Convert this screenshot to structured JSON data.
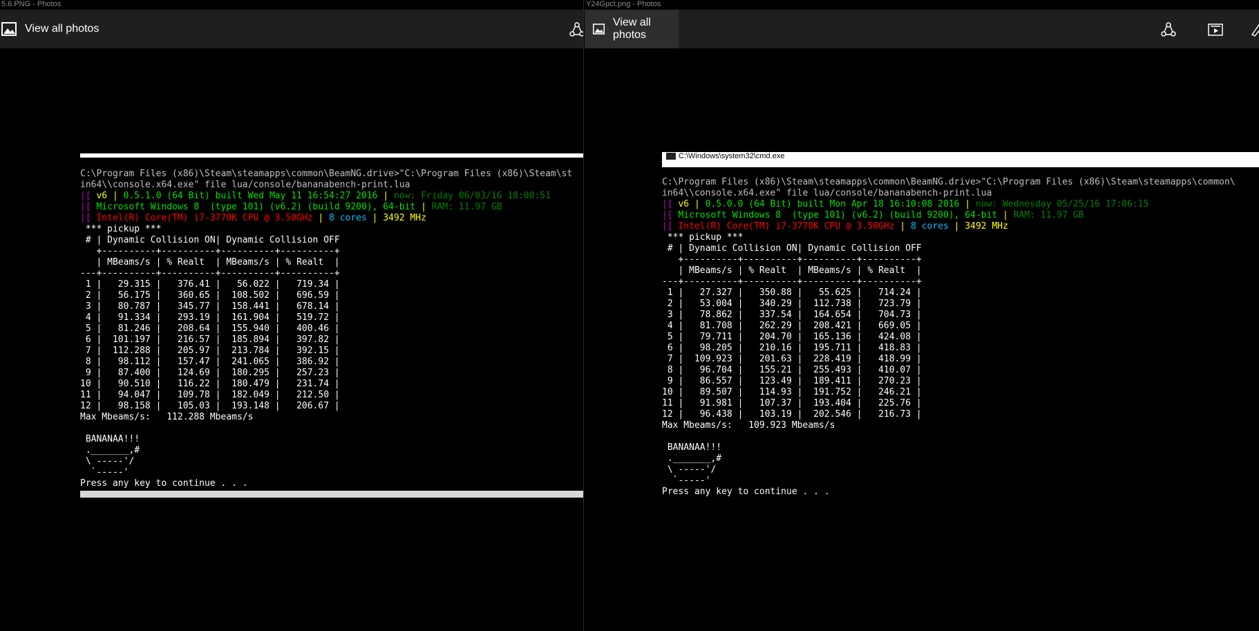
{
  "left_window": {
    "title": "5.6.PNG - Photos",
    "view_all": "View all photos",
    "icons": [
      "share-icon"
    ],
    "console": {
      "cmd_line1": "C:\\Program Files (x86)\\Steam\\steamapps\\common\\BeamNG.drive>\"C:\\Program Files (x86)\\Steam\\st",
      "cmd_line2": "in64\\\\console.x64.exe\" file lua/console/bananabench-print.lua",
      "info1": {
        "p1": "|[",
        "p2": " v6 ",
        "p3": "| ",
        "p4": "0.5.1.0 (64 Bit) built Wed May 11 16:54:27 2016 ",
        "p5": "| ",
        "p6": "now: Friday 06/03/16 18:00:51"
      },
      "info2": {
        "p1": "|[",
        "p2": " Microsoft Windows 8  (type 101) (v6.2) (build 9200), 64-bit ",
        "p3": "| ",
        "p4": "RAM: 11.97 GB"
      },
      "info3": {
        "p1": "|[",
        "p2": " Intel(R) Core(TM) i7-3770K CPU @ 3.50GHz ",
        "p3": "| ",
        "p4": "8 cores ",
        "p5": "| ",
        "p6": "3492 MHz"
      },
      "table_lines": [
        " *** pickup ***",
        " # | Dynamic Collision ON| Dynamic Collision OFF",
        "   +----------+----------+----------+----------+",
        "   | MBeams/s | % Realt  | MBeams/s | % Realt  |",
        "---+----------+----------+----------+----------+",
        " 1 |   29.315 |   376.41 |   56.022 |   719.34 |",
        " 2 |   56.175 |   360.65 |  108.502 |   696.59 |",
        " 3 |   80.787 |   345.77 |  158.441 |   678.14 |",
        " 4 |   91.334 |   293.19 |  161.904 |   519.72 |",
        " 5 |   81.246 |   208.64 |  155.940 |   400.46 |",
        " 6 |  101.197 |   216.57 |  185.894 |   397.82 |",
        " 7 |  112.288 |   205.97 |  213.784 |   392.15 |",
        " 8 |   98.112 |   157.47 |  241.065 |   386.92 |",
        " 9 |   87.400 |   124.69 |  180.295 |   257.23 |",
        "10 |   90.510 |   116.22 |  180.479 |   231.74 |",
        "11 |   94.047 |   109.78 |  182.049 |   212.50 |",
        "12 |   98.158 |   105.03 |  193.148 |   206.67 |",
        "Max Mbeams/s:   112.288 Mbeams/s",
        "",
        " BANANAA!!!",
        " ._______,#",
        " \\ -----'/",
        "  `-----'",
        "Press any key to continue . . ."
      ]
    }
  },
  "right_window": {
    "title": "Y24Gpct.png - Photos",
    "view_all": "View all photos",
    "icons": [
      "share-icon",
      "slideshow-icon",
      "draw-icon"
    ],
    "console": {
      "window_title": "C:\\Windows\\system32\\cmd.exe",
      "cmd_line1": "C:\\Program Files (x86)\\Steam\\steamapps\\common\\BeamNG.drive>\"C:\\Program Files (x86)\\Steam\\steamapps\\common\\",
      "cmd_line2": "in64\\\\console.x64.exe\" file lua/console/bananabench-print.lua",
      "info1": {
        "p1": "|[",
        "p2": " v6 ",
        "p3": "| ",
        "p4": "0.5.0.0 (64 Bit) built Mon Apr 18 16:10:08 2016 ",
        "p5": "| ",
        "p6": "now: Wednesday 05/25/16 17:06:15"
      },
      "info2": {
        "p1": "|[",
        "p2": " Microsoft Windows 8  (type 101) (v6.2) (build 9200), 64-bit ",
        "p3": "| ",
        "p4": "RAM: 11.97 GB"
      },
      "info3": {
        "p1": "|[",
        "p2": " Intel(R) Core(TM) i7-3770K CPU @ 3.50GHz ",
        "p3": "| ",
        "p4": "8 cores ",
        "p5": "| ",
        "p6": "3492 MHz"
      },
      "table_lines": [
        " *** pickup ***",
        " # | Dynamic Collision ON| Dynamic Collision OFF",
        "   +----------+----------+----------+----------+",
        "   | MBeams/s | % Realt  | MBeams/s | % Realt  |",
        "---+----------+----------+----------+----------+",
        " 1 |   27.327 |   350.88 |   55.625 |   714.24 |",
        " 2 |   53.004 |   340.29 |  112.738 |   723.79 |",
        " 3 |   78.862 |   337.54 |  164.654 |   704.73 |",
        " 4 |   81.708 |   262.29 |  208.421 |   669.05 |",
        " 5 |   79.711 |   204.70 |  165.136 |   424.08 |",
        " 6 |   98.205 |   210.16 |  195.711 |   418.83 |",
        " 7 |  109.923 |   201.63 |  228.419 |   418.99 |",
        " 8 |   96.704 |   155.21 |  255.493 |   410.07 |",
        " 9 |   86.557 |   123.49 |  189.411 |   270.23 |",
        "10 |   89.507 |   114.93 |  191.752 |   246.21 |",
        "11 |   91.981 |   107.37 |  193.404 |   225.76 |",
        "12 |   96.438 |   103.19 |  202.546 |   216.73 |",
        "Max Mbeams/s:   109.923 Mbeams/s",
        "",
        " BANANAA!!!",
        " ._______,#",
        " \\ -----'/",
        "  `-----'",
        "Press any key to continue . . ."
      ]
    }
  }
}
